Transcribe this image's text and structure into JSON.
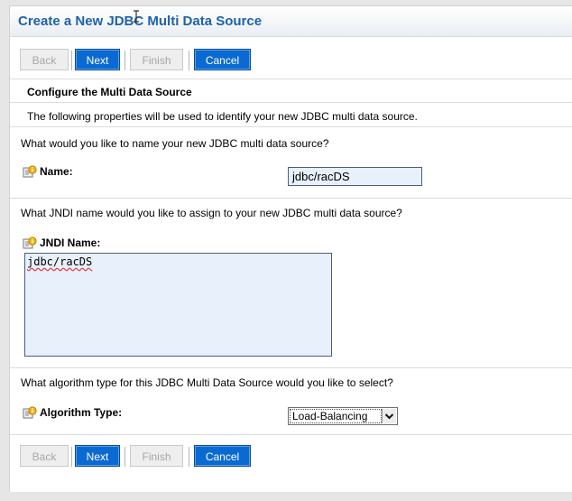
{
  "title": "Create a New JDBC Multi Data Source",
  "buttons": {
    "back": "Back",
    "next": "Next",
    "finish": "Finish",
    "cancel": "Cancel"
  },
  "section": {
    "heading": "Configure the Multi Data Source",
    "description": "The following properties will be used to identify your new JDBC multi data source."
  },
  "name_field": {
    "question": "What would you like to name your new JDBC multi data source?",
    "label": "Name:",
    "value": "jdbc/racDS"
  },
  "jndi_field": {
    "question": "What JNDI name would you like to assign to your new JDBC multi data source?",
    "label": "JNDI Name:",
    "value": "jdbc/racDS"
  },
  "algorithm_field": {
    "question": "What algorithm type for this JDBC Multi Data Source would you like to select?",
    "label": "Algorithm Type:",
    "selected": "Load-Balancing"
  },
  "icons": {
    "info": "info-icon",
    "cursor": "text-cursor-icon",
    "dropdown": "chevron-down-icon"
  },
  "colors": {
    "title": "#1f62a8",
    "button_active": "#0b6ad1",
    "input_bg": "#e7f0fb"
  }
}
